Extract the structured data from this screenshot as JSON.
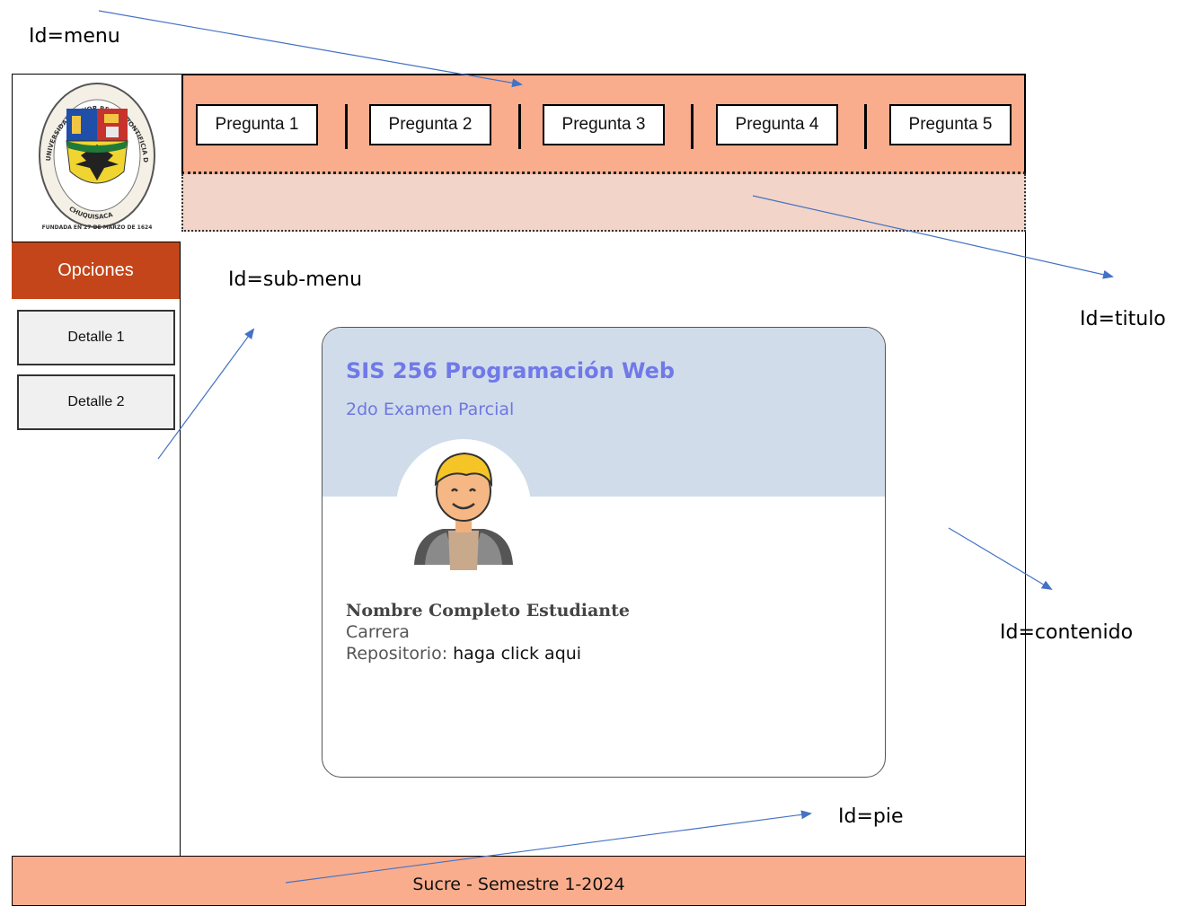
{
  "annotations": {
    "menu": "Id=menu",
    "sub_menu": "Id=sub-menu",
    "titulo": "Id=titulo",
    "contenido": "Id=contenido",
    "pie": "Id=pie"
  },
  "menu": {
    "items": [
      {
        "label": "Pregunta 1"
      },
      {
        "label": "Pregunta 2"
      },
      {
        "label": "Pregunta 3"
      },
      {
        "label": "Pregunta 4"
      },
      {
        "label": "Pregunta 5"
      }
    ]
  },
  "logo": {
    "text_top": "UNIVERSIDAD MAYOR REAL Y PONTIFICIA DE SAN FRANCISCO XAVIER",
    "text_middle": "CHUQUISACA",
    "text_bottom": "FUNDADA EN 27 DE MARZO DE 1624"
  },
  "sidebar": {
    "header": "Opciones",
    "items": [
      {
        "label": "Detalle 1"
      },
      {
        "label": "Detalle 2"
      }
    ]
  },
  "card": {
    "course": "SIS 256 Programación Web",
    "exam": "2do Examen Parcial",
    "student_name": "Nombre Completo Estudiante",
    "career": "Carrera",
    "repo_label": "Repositorio:",
    "repo_link": "haga click aqui"
  },
  "footer": {
    "text": "Sucre - Semestre 1-2024"
  },
  "colors": {
    "menu_bg": "#f9ad8d",
    "titulo_bg": "#f3d4c8",
    "sidebar_header": "#c4451a",
    "card_header": "#d0dcea",
    "card_title": "#7079e8",
    "arrow": "#4472c4"
  }
}
